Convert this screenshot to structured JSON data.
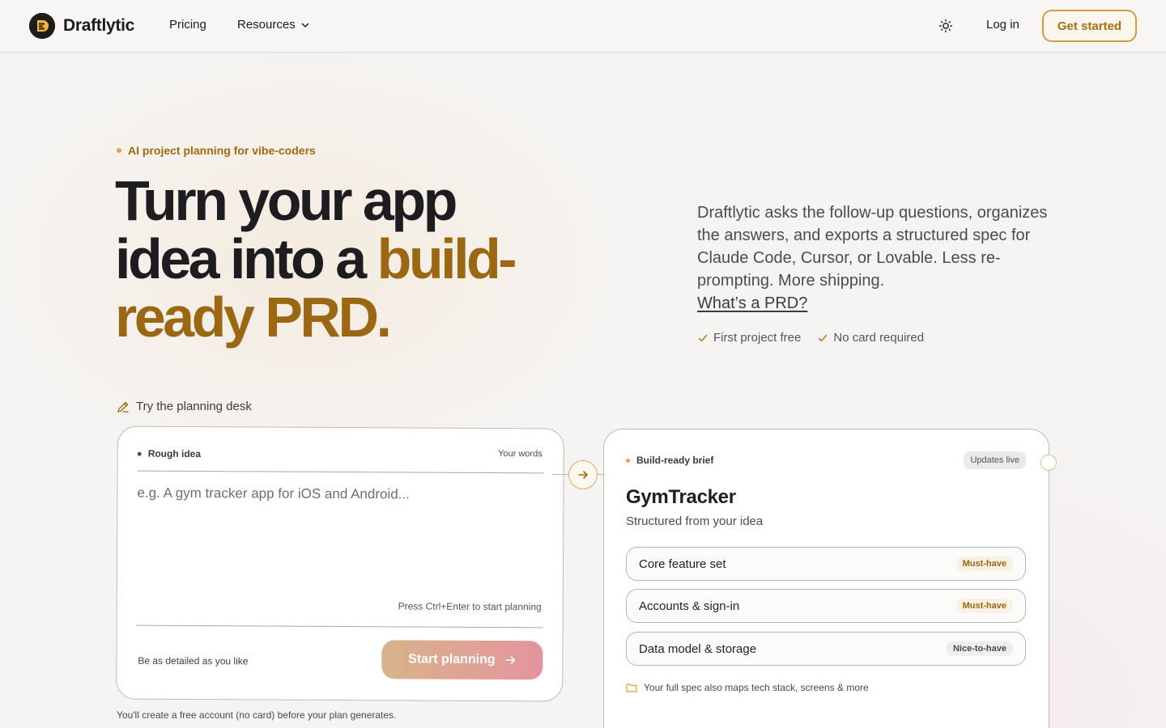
{
  "brand": {
    "name": "Draftlytic"
  },
  "nav": {
    "pricing": "Pricing",
    "resources": "Resources",
    "login": "Log in",
    "get_started": "Get started"
  },
  "hero": {
    "eyebrow": "AI project planning for vibe-coders",
    "headline_part1": "Turn your app idea into a ",
    "headline_accent": "build-ready PRD.",
    "description": "Draftlytic asks the follow-up questions, organizes the answers, and exports a structured spec for Claude Code, Cursor, or Lovable. Less re-prompting. More shipping.",
    "description_link": "What’s a PRD?",
    "checks": [
      "First project free",
      "No card required"
    ]
  },
  "planning_desk": {
    "label": "Try the planning desk",
    "input_card": {
      "title": "Rough idea",
      "meta": "Your words",
      "placeholder": "e.g. A gym tracker app for iOS and Android...",
      "value": "",
      "shortcut_hint": "Press Ctrl+Enter to start planning",
      "detail_hint": "Be as detailed as you like",
      "button": "Start planning"
    },
    "output_card": {
      "title": "Build-ready brief",
      "badge": "Updates live",
      "app_name": "GymTracker",
      "subtitle": "Structured from your idea",
      "features": [
        {
          "label": "Core feature set",
          "tag": "Must-have"
        },
        {
          "label": "Accounts & sign-in",
          "tag": "Must-have"
        },
        {
          "label": "Data model & storage",
          "tag": "Nice-to-have"
        }
      ],
      "footnote": "Your full spec also maps tech stack, screens & more"
    },
    "account_note": "You'll create a free account (no card) before your plan generates."
  },
  "colors": {
    "accent": "#9b6712",
    "accent_light": "#e0a44a",
    "button_gradient_start": "#d8b38a",
    "button_gradient_end": "#e5949e"
  }
}
